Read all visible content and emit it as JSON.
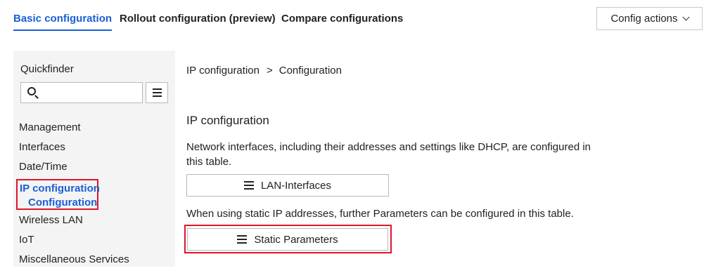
{
  "tabs": [
    {
      "label": "Basic configuration",
      "active": true
    },
    {
      "label": "Rollout configuration (preview)",
      "active": false
    },
    {
      "label": "Compare configurations",
      "active": false
    }
  ],
  "config_actions": {
    "label": "Config actions",
    "icon": "chevron-down-icon"
  },
  "sidebar": {
    "title": "Quickfinder",
    "search": {
      "value": "",
      "placeholder": "",
      "icon": "search-icon"
    },
    "menu_icon": "hamburger-menu-icon",
    "items": [
      {
        "label": "Management"
      },
      {
        "label": "Interfaces"
      },
      {
        "label": "Date/Time"
      },
      {
        "label": "IP configuration",
        "sub_label": "Configuration",
        "active": true
      },
      {
        "label": "Wireless LAN"
      },
      {
        "label": "IoT"
      },
      {
        "label": "Miscellaneous Services"
      }
    ]
  },
  "main": {
    "breadcrumb": [
      "IP configuration",
      "Configuration"
    ],
    "breadcrumb_separator": ">",
    "section_title": "IP configuration",
    "desc1": "Network interfaces, including their addresses and settings like DHCP, are configured in this table.",
    "button1": "LAN-Interfaces",
    "desc2": "When using static IP addresses, further Parameters can be configured in this table.",
    "button2": "Static Parameters"
  },
  "colors": {
    "accent": "#1a5fd6",
    "highlight_border": "#e0142b",
    "sidebar_bg": "#f4f4f4"
  }
}
